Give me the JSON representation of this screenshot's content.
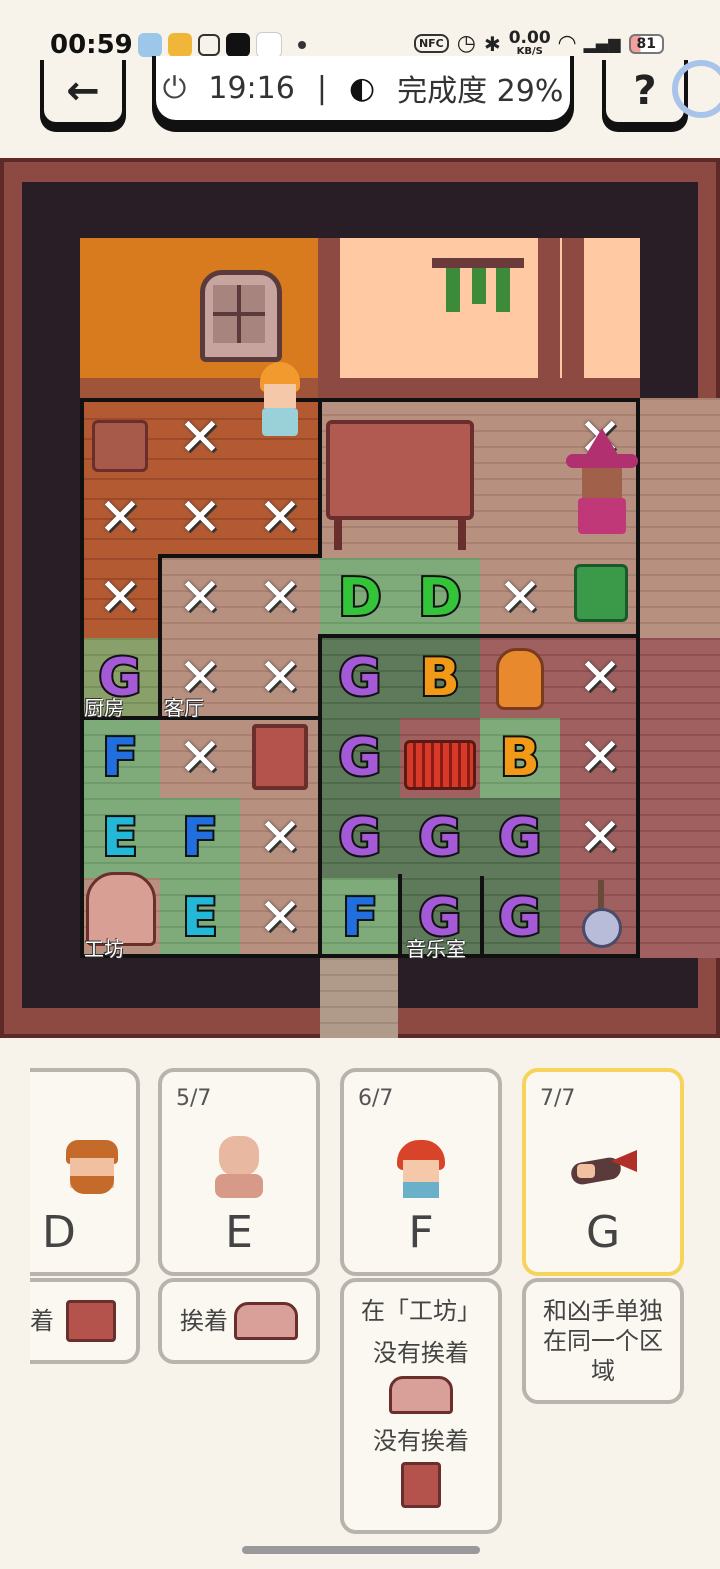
{
  "status": {
    "time": "00:59",
    "net_speed": "0.00",
    "net_unit": "KB/S",
    "battery": "81"
  },
  "topbar": {
    "timer": "19:16",
    "progress_label": "完成度 29%",
    "back_icon": "←",
    "help_icon": "?"
  },
  "regions": {
    "kitchen": "厨房",
    "living": "客厅",
    "workshop": "工坊",
    "music": "音乐室"
  },
  "grid": {
    "cells": [
      [
        {
          "t": ""
        },
        {
          "t": "x"
        },
        {
          "t": ""
        },
        {
          "t": ""
        },
        {
          "t": ""
        },
        {
          "t": ""
        },
        {
          "t": "x"
        },
        {
          "t": ""
        }
      ],
      [
        {
          "t": "x"
        },
        {
          "t": "x"
        },
        {
          "t": "x"
        },
        {
          "t": ""
        },
        {
          "t": ""
        },
        {
          "t": ""
        },
        {
          "t": "x"
        },
        {
          "t": ""
        }
      ],
      [
        {
          "t": "x"
        },
        {
          "t": "x"
        },
        {
          "t": "x"
        },
        {
          "t": "D"
        },
        {
          "t": "D"
        },
        {
          "t": "x"
        },
        {
          "t": "x"
        },
        {
          "t": ""
        }
      ],
      [
        {
          "t": "G"
        },
        {
          "t": "x"
        },
        {
          "t": "x"
        },
        {
          "t": "G"
        },
        {
          "t": "B"
        },
        {
          "t": ""
        },
        {
          "t": "x"
        },
        {
          "t": ""
        }
      ],
      [
        {
          "t": "F"
        },
        {
          "t": "x"
        },
        {
          "t": ""
        },
        {
          "t": "G"
        },
        {
          "t": ""
        },
        {
          "t": "B"
        },
        {
          "t": "x"
        },
        {
          "t": ""
        }
      ],
      [
        {
          "t": "E"
        },
        {
          "t": "F"
        },
        {
          "t": "x"
        },
        {
          "t": "G"
        },
        {
          "t": "G"
        },
        {
          "t": "G"
        },
        {
          "t": "x"
        },
        {
          "t": ""
        }
      ],
      [
        {
          "t": ""
        },
        {
          "t": "E"
        },
        {
          "t": "x"
        },
        {
          "t": "F"
        },
        {
          "t": "G"
        },
        {
          "t": "G"
        },
        {
          "t": ""
        },
        {
          "t": ""
        }
      ]
    ]
  },
  "cards": [
    {
      "count": "",
      "letter": "D"
    },
    {
      "count": "5/7",
      "letter": "E"
    },
    {
      "count": "6/7",
      "letter": "F"
    },
    {
      "count": "7/7",
      "letter": "G"
    }
  ],
  "clues": {
    "d": "着",
    "e": "挨着",
    "f_line1": "在「工坊」",
    "f_line2": "没有挨着",
    "f_line3": "没有挨着",
    "g": "和凶手单独在同一个区域"
  },
  "letter_colors": {
    "D": "#33c43a",
    "B": "#f29a18",
    "G": "#a45ad6",
    "F": "#1f6fe0",
    "E": "#22b8d8"
  }
}
